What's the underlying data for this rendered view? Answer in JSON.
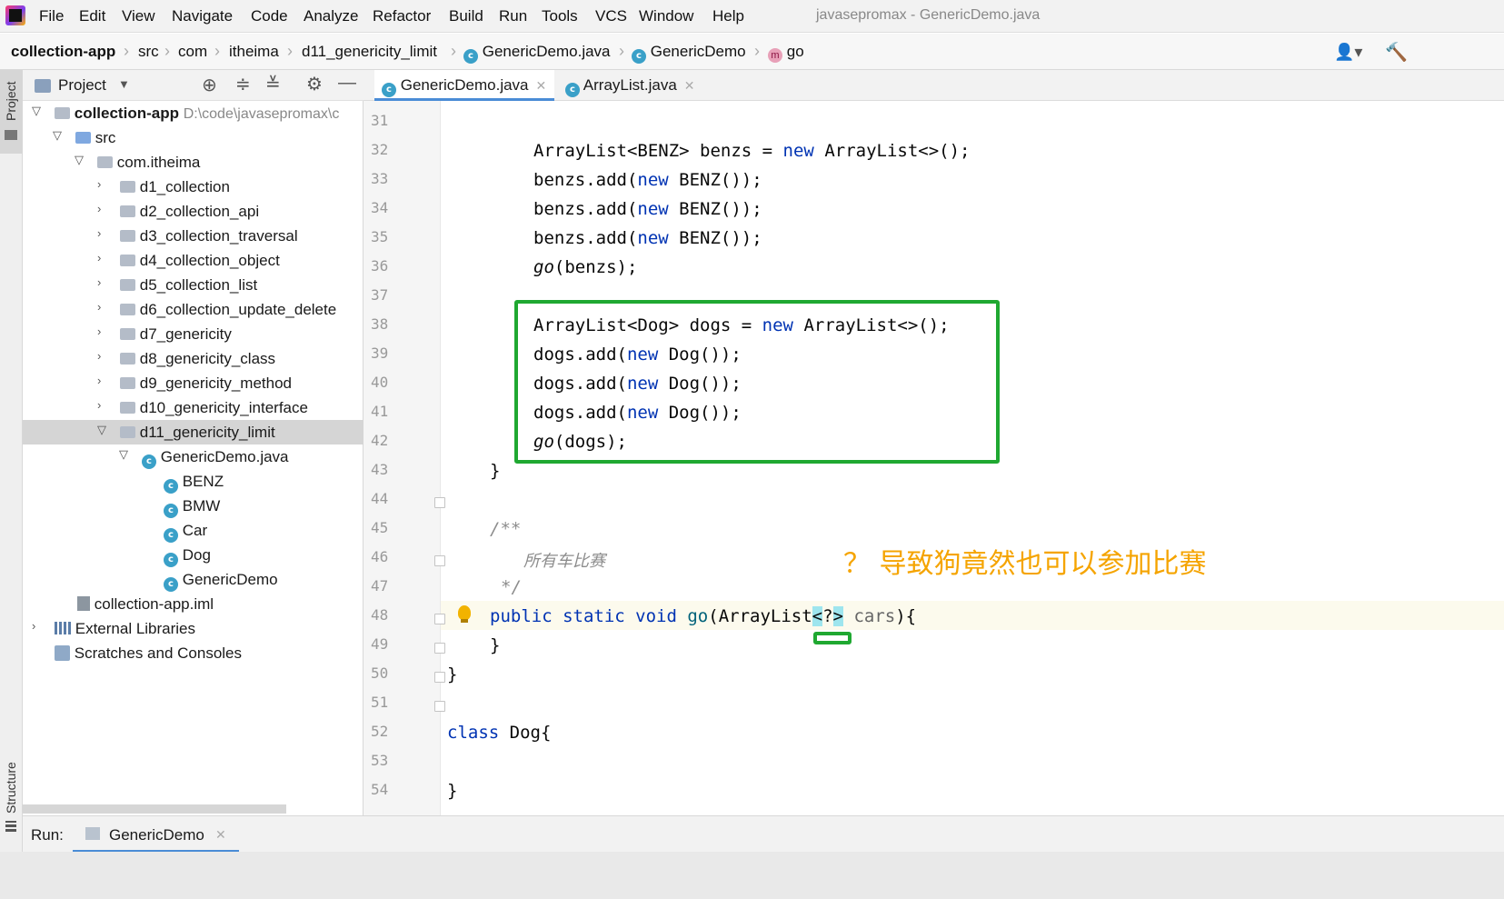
{
  "menubar": {
    "items": [
      "File",
      "Edit",
      "View",
      "Navigate",
      "Code",
      "Analyze",
      "Refactor",
      "Build",
      "Run",
      "Tools",
      "VCS",
      "Window",
      "Help"
    ],
    "window_title": "javasepromax - GenericDemo.java"
  },
  "breadcrumb": {
    "items": [
      "collection-app",
      "src",
      "com",
      "itheima",
      "d11_genericity_limit",
      "GenericDemo.java",
      "GenericDemo",
      "go"
    ]
  },
  "left_strip": {
    "project_label": "Project",
    "structure_label": "Structure"
  },
  "project_panel": {
    "title": "Project",
    "root_name": "collection-app",
    "root_path": "D:\\code\\javasepromax\\c",
    "src": "src",
    "package": "com.itheima",
    "folders": [
      "d1_collection",
      "d2_collection_api",
      "d3_collection_traversal",
      "d4_collection_object",
      "d5_collection_list",
      "d6_collection_update_delete",
      "d7_genericity",
      "d8_genericity_class",
      "d9_genericity_method",
      "d10_genericity_interface",
      "d11_genericity_limit"
    ],
    "file": "GenericDemo.java",
    "classes": [
      "BENZ",
      "BMW",
      "Car",
      "Dog",
      "GenericDemo"
    ],
    "iml": "collection-app.iml",
    "external": "External Libraries",
    "scratches": "Scratches and Consoles"
  },
  "editor": {
    "tabs": [
      {
        "label": "GenericDemo.java",
        "active": true
      },
      {
        "label": "ArrayList.java",
        "active": false
      }
    ],
    "line_numbers": [
      "31",
      "32",
      "33",
      "34",
      "35",
      "36",
      "37",
      "38",
      "39",
      "40",
      "41",
      "42",
      "43",
      "44",
      "45",
      "46",
      "47",
      "48",
      "49",
      "50",
      "51",
      "52",
      "53",
      "54"
    ],
    "code": {
      "l32a": "ArrayList<BENZ> benzs = ",
      "l32kw": "new",
      "l32b": " ArrayList<>();",
      "add_benz_a": "benzs.add(",
      "kw_new": "new",
      "add_benz_b": " BENZ());",
      "go": "go",
      "go_benz": "(benzs);",
      "l38a": "ArrayList<Dog> dogs = ",
      "l38b": " ArrayList<>();",
      "add_dog_a": "dogs.add(",
      "add_dog_b": " Dog());",
      "go_dog": "(dogs);",
      "close_brace": "}",
      "doc_open": "/**",
      "doc_text": "所有车比赛",
      "doc_close": "*/",
      "l48_kw": "public static void",
      "l48_fn": "go",
      "l48_a": "(ArrayList",
      "l48_lt": "<",
      "l48_q": "?",
      "l48_gt": ">",
      "l48_param": " cars",
      "l48_end": "){",
      "class_kw": "class",
      "class_name": " Dog{"
    },
    "annotation": "？ 导致狗竟然也可以参加比赛"
  },
  "runbar": {
    "label": "Run:",
    "tab": "GenericDemo"
  }
}
